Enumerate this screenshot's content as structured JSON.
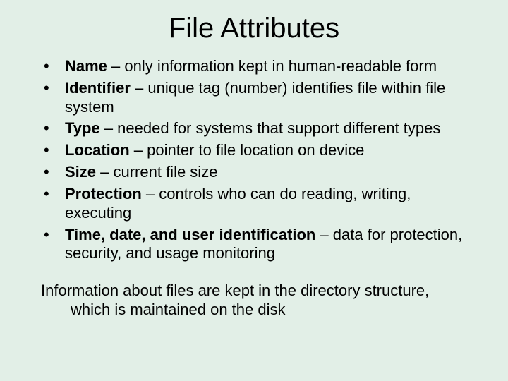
{
  "title": "File Attributes",
  "bullets": [
    {
      "term": "Name",
      "desc": " – only information kept in human-readable form"
    },
    {
      "term": "Identifier",
      "desc": " – unique tag (number) identifies file within file system"
    },
    {
      "term": "Type",
      "desc": " – needed for systems that support different types"
    },
    {
      "term": "Location",
      "desc": " – pointer to file location on device"
    },
    {
      "term": "Size",
      "desc": " – current file size"
    },
    {
      "term": "Protection",
      "desc": " – controls who can do reading, writing, executing"
    },
    {
      "term": "Time, date, and user identification",
      "desc": " – data for protection, security, and usage monitoring"
    }
  ],
  "footer": "Information about files are kept in the directory structure, which is maintained on the disk"
}
